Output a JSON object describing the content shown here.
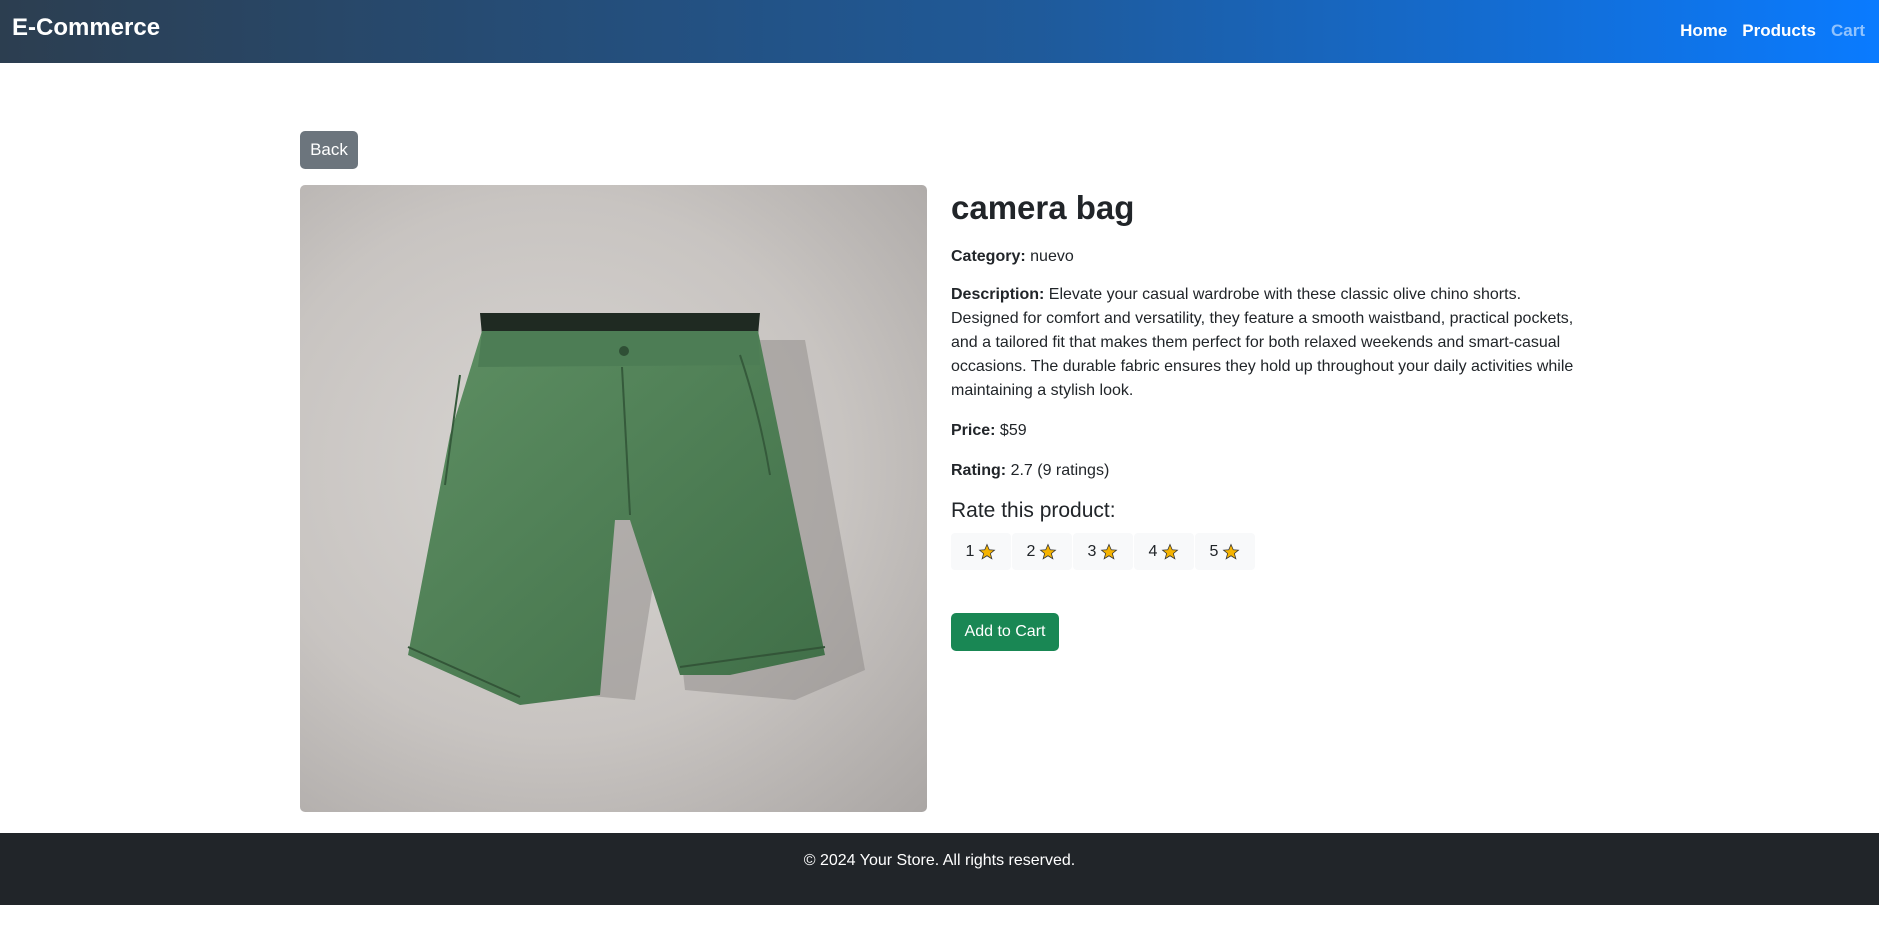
{
  "navbar": {
    "brand": "E-Commerce",
    "links": [
      "Home",
      "Products",
      "Cart"
    ]
  },
  "back_button": "Back",
  "product": {
    "image_icon": "shorts-photo",
    "title": "camera bag",
    "category_label": "Category:",
    "category_value": "nuevo",
    "description_label": "Description:",
    "description_value": "Elevate your casual wardrobe with these classic olive chino shorts. Designed for comfort and versatility, they feature a smooth waistband, practical pockets, and a tailored fit that makes them perfect for both relaxed weekends and smart-casual occasions. The durable fabric ensures they hold up throughout your daily activities while maintaining a stylish look.",
    "price_label": "Price:",
    "price_value": "$59",
    "rating_label": "Rating:",
    "rating_value": "2.7 (9 ratings)"
  },
  "rate": {
    "heading": "Rate this product:",
    "options": [
      "1",
      "2",
      "3",
      "4",
      "5"
    ],
    "icon": "star-icon"
  },
  "add_to_cart": "Add to Cart",
  "footer": {
    "text": "© 2024 Your Store. All rights reserved."
  },
  "colors": {
    "back_button": "#6c757d",
    "add_to_cart": "#198754",
    "footer": "#212529",
    "star": "#f5b301"
  }
}
